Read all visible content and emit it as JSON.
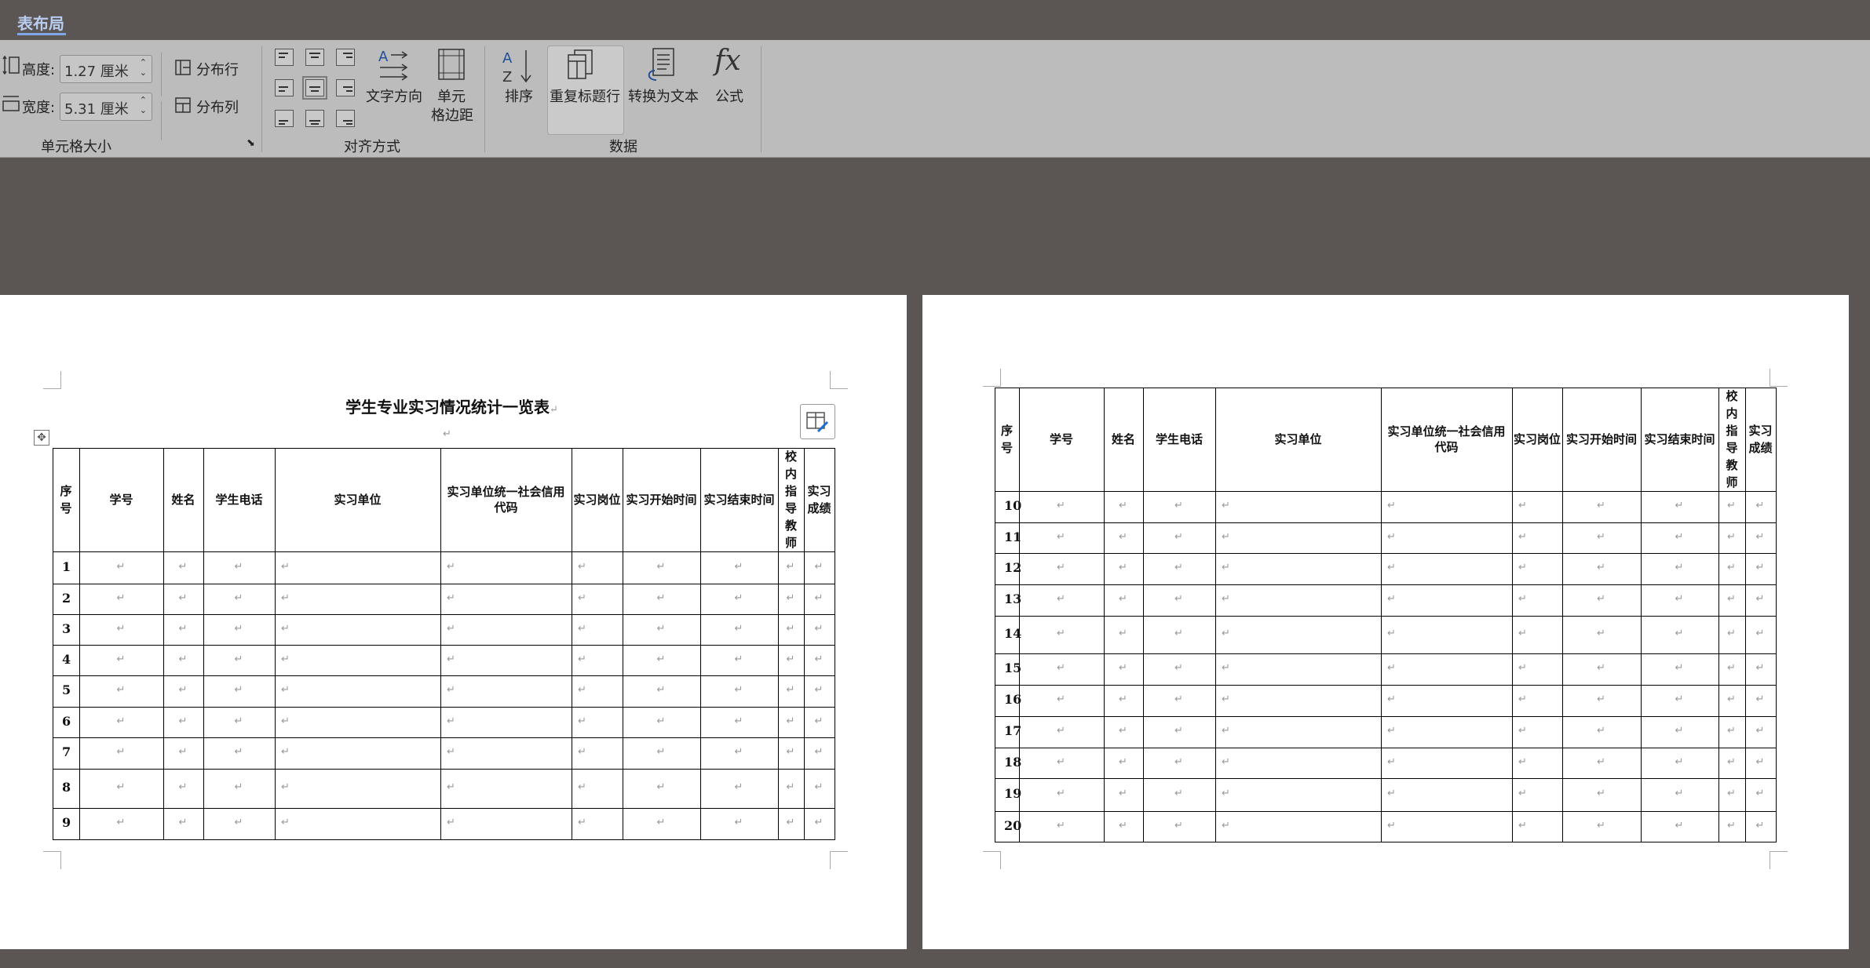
{
  "tabs": {
    "active": "表布局"
  },
  "ribbon": {
    "cell_size": {
      "height_label": "高度:",
      "height_value": "1.27 厘米",
      "width_label": "宽度:",
      "width_value": "5.31 厘米",
      "distribute_rows": "分布行",
      "distribute_cols": "分布列",
      "group_label": "单元格大小"
    },
    "alignment": {
      "text_direction": "文字方向",
      "cell_margins_line1": "单元",
      "cell_margins_line2": "格边距",
      "group_label": "对齐方式"
    },
    "data": {
      "sort": "排序",
      "repeat_header": "重复标题行",
      "convert_text": "转换为文本",
      "formula": "公式",
      "group_label": "数据"
    }
  },
  "document": {
    "title": "学生专业实习情况统计一览表",
    "headers": [
      "序号",
      "学号",
      "姓名",
      "学生电话",
      "实习单位",
      "实习单位统一社会信用代码",
      "实习岗位",
      "实习开始时间",
      "实习结束时间",
      "校内指导教师",
      "实习成绩"
    ],
    "page1_rows": [
      "1",
      "2",
      "3",
      "4",
      "5",
      "6",
      "7",
      "8",
      "9"
    ],
    "page2_rows": [
      "10",
      "11",
      "12",
      "13",
      "14",
      "15",
      "16",
      "17",
      "18",
      "19",
      "20"
    ],
    "para_mark": "↵"
  },
  "colors": {
    "window_bg": "#5b5553",
    "ribbon_bg": "#bcbcbc",
    "accent": "#7fa6e6"
  }
}
